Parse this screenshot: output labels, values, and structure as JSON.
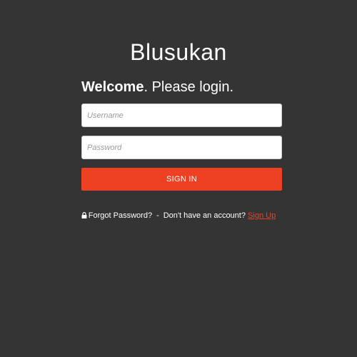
{
  "app": {
    "title": "Blusukan"
  },
  "login": {
    "welcome_bold": "Welcome",
    "welcome_rest": ". Please login.",
    "username_placeholder": "Username",
    "password_placeholder": "Password",
    "signin_label": "SIGN IN"
  },
  "footer": {
    "forgot_label": "Forgot Password?",
    "separator": "-",
    "no_account_text": "Don't have an account?",
    "signup_label": "Sign Up",
    "lock_icon": "lock-icon"
  },
  "colors": {
    "background": "#343434",
    "accent": "#ee4124",
    "text": "#ffffff"
  }
}
